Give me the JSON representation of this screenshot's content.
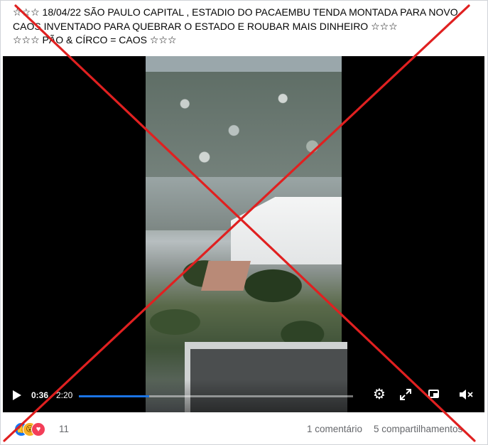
{
  "post": {
    "caption": "☆☆☆ 18/04/22  SÃO PAULO CAPITAL , ESTADIO DO PACAEMBU TENDA MONTADA PARA NOVO CAOS INVENTADO PARA QUEBRAR O ESTADO E ROUBAR MAIS DINHEIRO ☆☆☆\n☆☆☆ PÃO & CÍRCO = CAOS ☆☆☆"
  },
  "video": {
    "current_time": "0:36",
    "total_time": "2:20",
    "progress_fraction": 0.257,
    "icons": {
      "play": "play-icon",
      "settings": "gear-icon",
      "fullscreen": "expand-icon",
      "pip": "picture-in-picture-icon",
      "volume": "mute-icon"
    },
    "accent_color": "#1b74e4"
  },
  "footer": {
    "reaction_icons": [
      "like-icon",
      "wow-icon",
      "love-icon"
    ],
    "reaction_count": "11",
    "comments": "1 comentário",
    "shares": "5 compartilhamentos"
  },
  "overlay": {
    "symbol": "red-x",
    "color": "#e02020"
  }
}
